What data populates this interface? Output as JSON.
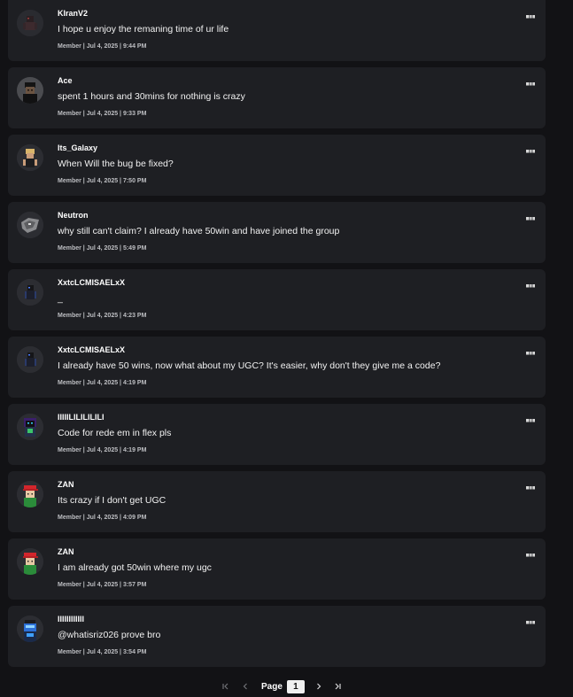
{
  "comments": [
    {
      "username": "KIranV2",
      "message": "I hope u enjoy the remaning time of ur life",
      "meta": "Member | Jul 4, 2025 | 9:44 PM",
      "avatar": "dark-figure-avatar"
    },
    {
      "username": "Ace",
      "message": "spent 1 hours and 30mins for nothing is crazy",
      "meta": "Member | Jul 4, 2025 | 9:33 PM",
      "avatar": "dark-hair-avatar"
    },
    {
      "username": "Its_Galaxy",
      "message": "When Will the bug be fixed?",
      "meta": "Member | Jul 4, 2025 | 7:50 PM",
      "avatar": "blonde-figure-avatar"
    },
    {
      "username": "Neutron",
      "message": "why still can't claim? I already have 50win and have joined the group",
      "meta": "Member | Jul 4, 2025 | 5:49 PM",
      "avatar": "grey-creature-avatar"
    },
    {
      "username": "XxtcLCMISAELxX",
      "message": "_",
      "meta": "Member | Jul 4, 2025 | 4:23 PM",
      "avatar": "blue-figure-avatar"
    },
    {
      "username": "XxtcLCMISAELxX",
      "message": "I already have 50 wins, now what about my UGC? It's easier, why don't they give me a code?",
      "meta": "Member | Jul 4, 2025 | 4:19 PM",
      "avatar": "blue-figure-avatar"
    },
    {
      "username": "IIIIILILILILILI",
      "message": "Code for rede em in flex pls",
      "meta": "Member | Jul 4, 2025 | 4:19 PM",
      "avatar": "purple-figure-avatar"
    },
    {
      "username": "ZAN",
      "message": "Its crazy if I don't get UGC",
      "meta": "Member | Jul 4, 2025 | 4:09 PM",
      "avatar": "red-cap-avatar"
    },
    {
      "username": "ZAN",
      "message": "I am already got 50win where my ugc",
      "meta": "Member | Jul 4, 2025 | 3:57 PM",
      "avatar": "red-cap-avatar"
    },
    {
      "username": "IIIIIIIIIIII",
      "message": "@whatisriz026 prove bro",
      "meta": "Member | Jul 4, 2025 | 3:54 PM",
      "avatar": "blue-visor-avatar"
    }
  ],
  "pagination": {
    "label": "Page",
    "current": "1",
    "icons": {
      "first": "first-page-icon",
      "prev": "previous-page-icon",
      "next": "next-page-icon",
      "last": "last-page-icon"
    }
  },
  "icons": {
    "more": "more-options-icon"
  },
  "colors": {
    "background": "#121215",
    "card": "#1e1f23",
    "text": "#ffffff",
    "meta_text": "#bdbec2"
  }
}
